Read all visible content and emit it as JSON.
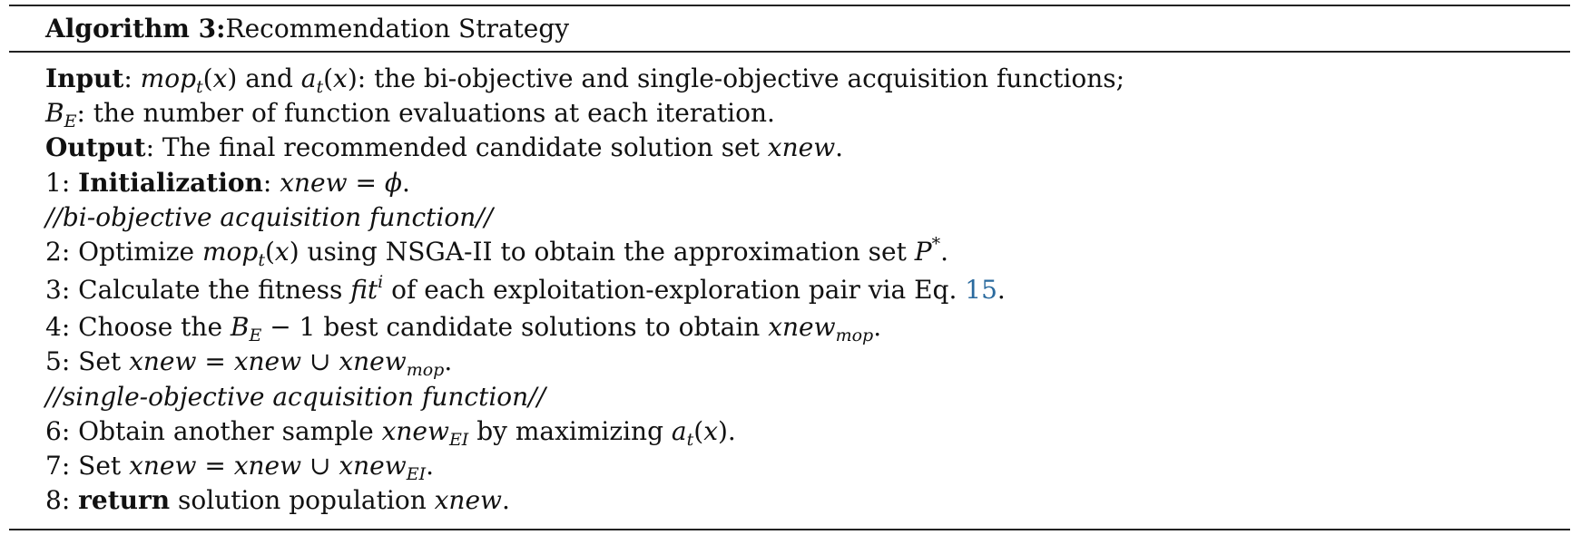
{
  "algorithm": {
    "label": "Algorithm 3:",
    "title": "Recommendation Strategy"
  },
  "lines": {
    "input_label": "Input",
    "input_rest": ": the bi-objective and single-objective acquisition functions;",
    "be_rest": ": the number of function evaluations at each iteration.",
    "output_label": "Output",
    "output_rest": ": The final recommended candidate solution set ",
    "step1_num": "1: ",
    "step1_label": "Initialization",
    "comment_bi": "//bi-objective acquisition function//",
    "step2_pre": "2: Optimize ",
    "step2_mid": " using NSGA-II to obtain the approximation set ",
    "step3_pre": "3: Calculate the fitness ",
    "step3_mid": " of each exploitation-exploration pair via Eq. ",
    "step3_ref": "15",
    "step4_pre": "4: Choose the ",
    "step4_mid": " best candidate solutions to obtain ",
    "step5_pre": "5: Set ",
    "comment_single": "//single-objective acquisition function//",
    "step6_pre": "6: Obtain another sample ",
    "step6_mid": " by maximizing ",
    "step7_pre": "7: Set ",
    "step8_num": "8: ",
    "step8_label": "return",
    "step8_rest": " solution population "
  }
}
